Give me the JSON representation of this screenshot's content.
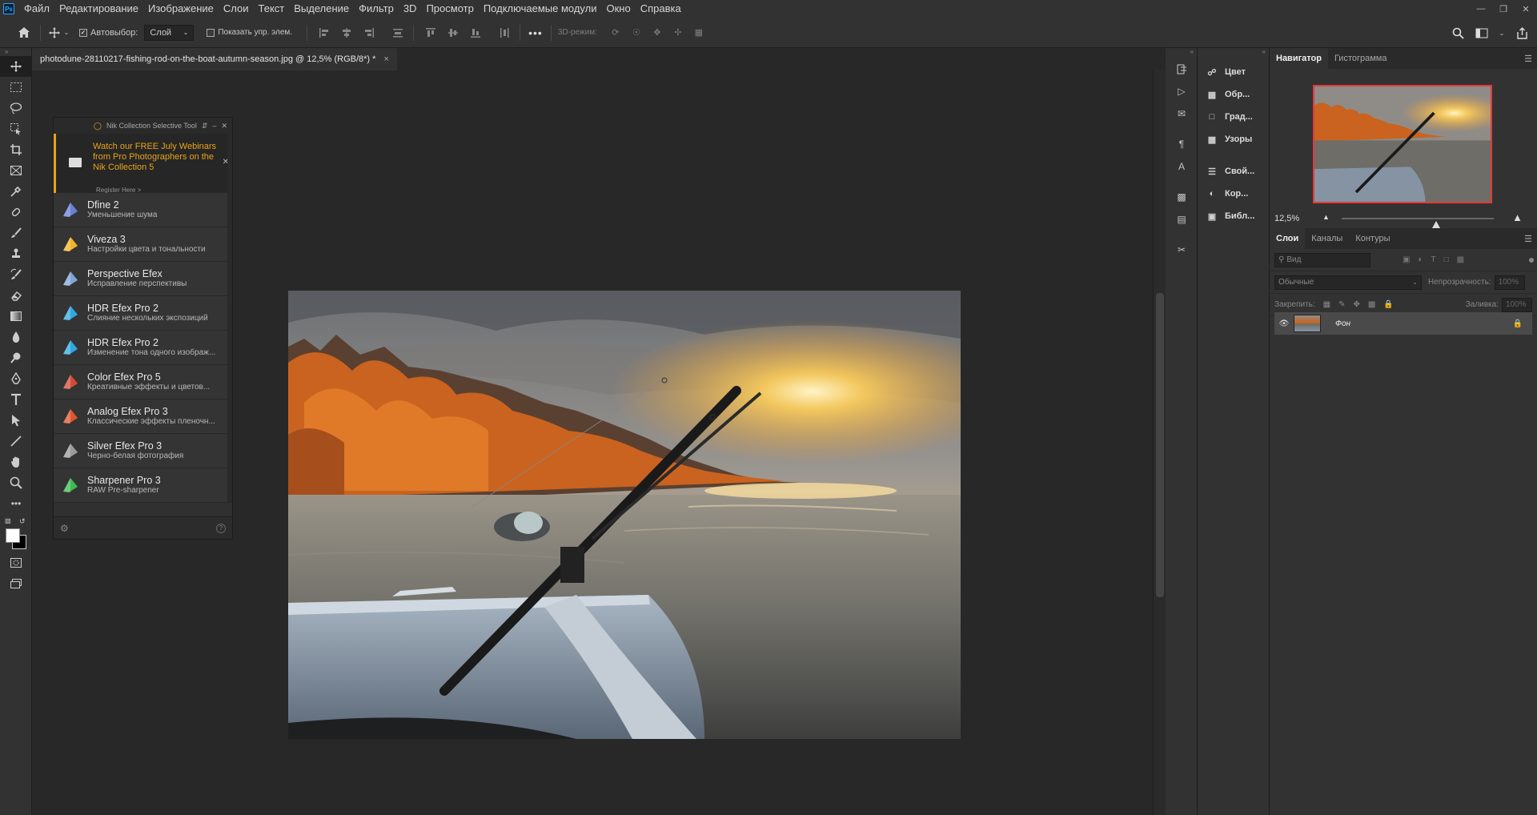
{
  "menubar": {
    "logo": "Ps",
    "items": [
      "Файл",
      "Редактирование",
      "Изображение",
      "Слои",
      "Текст",
      "Выделение",
      "Фильтр",
      "3D",
      "Просмотр",
      "Подключаемые модули",
      "Окно",
      "Справка"
    ]
  },
  "options": {
    "autoselect_label": "Автовыбор:",
    "autoselect_value": "Слой",
    "show_transform_label": "Показать упр. элем.",
    "mode3d_label": "3D-режим:",
    "more_label": "•••"
  },
  "document": {
    "tab_title": "photodune-28110217-fishing-rod-on-the-boat-autumn-season.jpg @ 12,5% (RGB/8*) *",
    "close": "×"
  },
  "nik": {
    "title": "Nik Collection Selective Tool",
    "promo_text": "Watch our FREE July Webinars from Pro Photographers on the Nik Collection 5",
    "promo_link": "Register Here >",
    "items": [
      {
        "name": "Dfine 2",
        "desc": "Уменьшение шума",
        "color": "#6a7fd4"
      },
      {
        "name": "Viveza 3",
        "desc": "Настройки цвета и тональности",
        "color": "#f0b429"
      },
      {
        "name": "Perspective Efex",
        "desc": "Исправление перспективы",
        "color": "#7ea6d8"
      },
      {
        "name": "HDR Efex Pro 2",
        "desc": "Слияние нескольких экспозиций",
        "color": "#2fa8e0"
      },
      {
        "name": "HDR Efex Pro 2",
        "desc": "Изменение тона одного изображ...",
        "color": "#2fa8e0"
      },
      {
        "name": "Color Efex Pro 5",
        "desc": "Креативные эффекты и цветов...",
        "color": "#d64a3a"
      },
      {
        "name": "Analog Efex Pro 3",
        "desc": "Классические эффекты пленочн...",
        "color": "#e0552e"
      },
      {
        "name": "Silver Efex Pro 3",
        "desc": "Черно-белая фотография",
        "color": "#9a9a9a"
      },
      {
        "name": "Sharpener Pro 3",
        "desc": "RAW Pre-sharpener",
        "color": "#3dbb4f"
      }
    ]
  },
  "panelsA": {
    "items": [
      {
        "label": "Цвет",
        "icon": "color-icon"
      },
      {
        "label": "Обр...",
        "icon": "swatches-icon"
      },
      {
        "label": "Град...",
        "icon": "gradient-icon"
      },
      {
        "label": "Узоры",
        "icon": "patterns-icon"
      },
      {
        "label": "Свой...",
        "icon": "properties-icon"
      },
      {
        "label": "Кор...",
        "icon": "adjustments-icon"
      },
      {
        "label": "Библ...",
        "icon": "libraries-icon"
      }
    ]
  },
  "navigator": {
    "tabs": [
      "Навигатор",
      "Гистограмма"
    ],
    "zoom": "12,5%",
    "zoom_fraction": 0.62
  },
  "layers": {
    "tabs": [
      "Слои",
      "Каналы",
      "Контуры"
    ],
    "filter_placeholder": "Вид",
    "blend_mode": "Обычные",
    "opacity_label": "Непрозрачность:",
    "opacity_value": "100%",
    "lock_label": "Закрепить:",
    "fill_label": "Заливка:",
    "fill_value": "100%",
    "layer_name": "Фон"
  }
}
